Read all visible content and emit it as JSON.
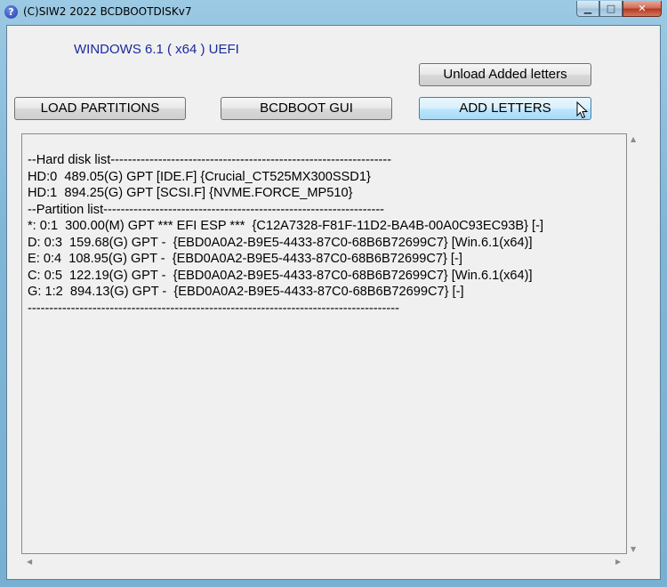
{
  "window": {
    "title": "(C)SIW2 2022 BCDBOOTDISKv7",
    "icon": "help-icon",
    "caption": {
      "minimize_glyph": "▁",
      "maximize_glyph": "□",
      "close_glyph": "✕"
    }
  },
  "header": {
    "os_label": "WINDOWS 6.1 ( x64 ) UEFI"
  },
  "buttons": {
    "unload_label": "Unload Added letters",
    "load_partitions_label": "LOAD PARTITIONS",
    "bcdboot_gui_label": "BCDBOOT GUI",
    "add_letters_label": "ADD LETTERS"
  },
  "output": {
    "lines": [
      "--Hard disk list-----------------------------------------------------------------",
      "HD:0  489.05(G) GPT [IDE.F] {Crucial_CT525MX300SSD1}",
      "HD:1  894.25(G) GPT [SCSI.F] {NVME.FORCE_MP510}",
      "--Partition list-----------------------------------------------------------------",
      "*: 0:1  300.00(M) GPT *** EFI ESP ***  {C12A7328-F81F-11D2-BA4B-00A0C93EC93B} [-]",
      "D: 0:3  159.68(G) GPT -  {EBD0A0A2-B9E5-4433-87C0-68B6B72699C7} [Win.6.1(x64)]",
      "E: 0:4  108.95(G) GPT -  {EBD0A0A2-B9E5-4433-87C0-68B6B72699C7} [-]",
      "C: 0:5  122.19(G) GPT -  {EBD0A0A2-B9E5-4433-87C0-68B6B72699C7} [Win.6.1(x64)]",
      "G: 1:2  894.13(G) GPT -  {EBD0A0A2-B9E5-4433-87C0-68B6B72699C7} [-]",
      "--------------------------------------------------------------------------------------"
    ]
  },
  "scrollbars": {
    "up": "▲",
    "down": "▼",
    "left": "◀",
    "right": "▶"
  },
  "colors": {
    "os_label": "#1b2a9c",
    "hot_button": "#bee6fd"
  }
}
